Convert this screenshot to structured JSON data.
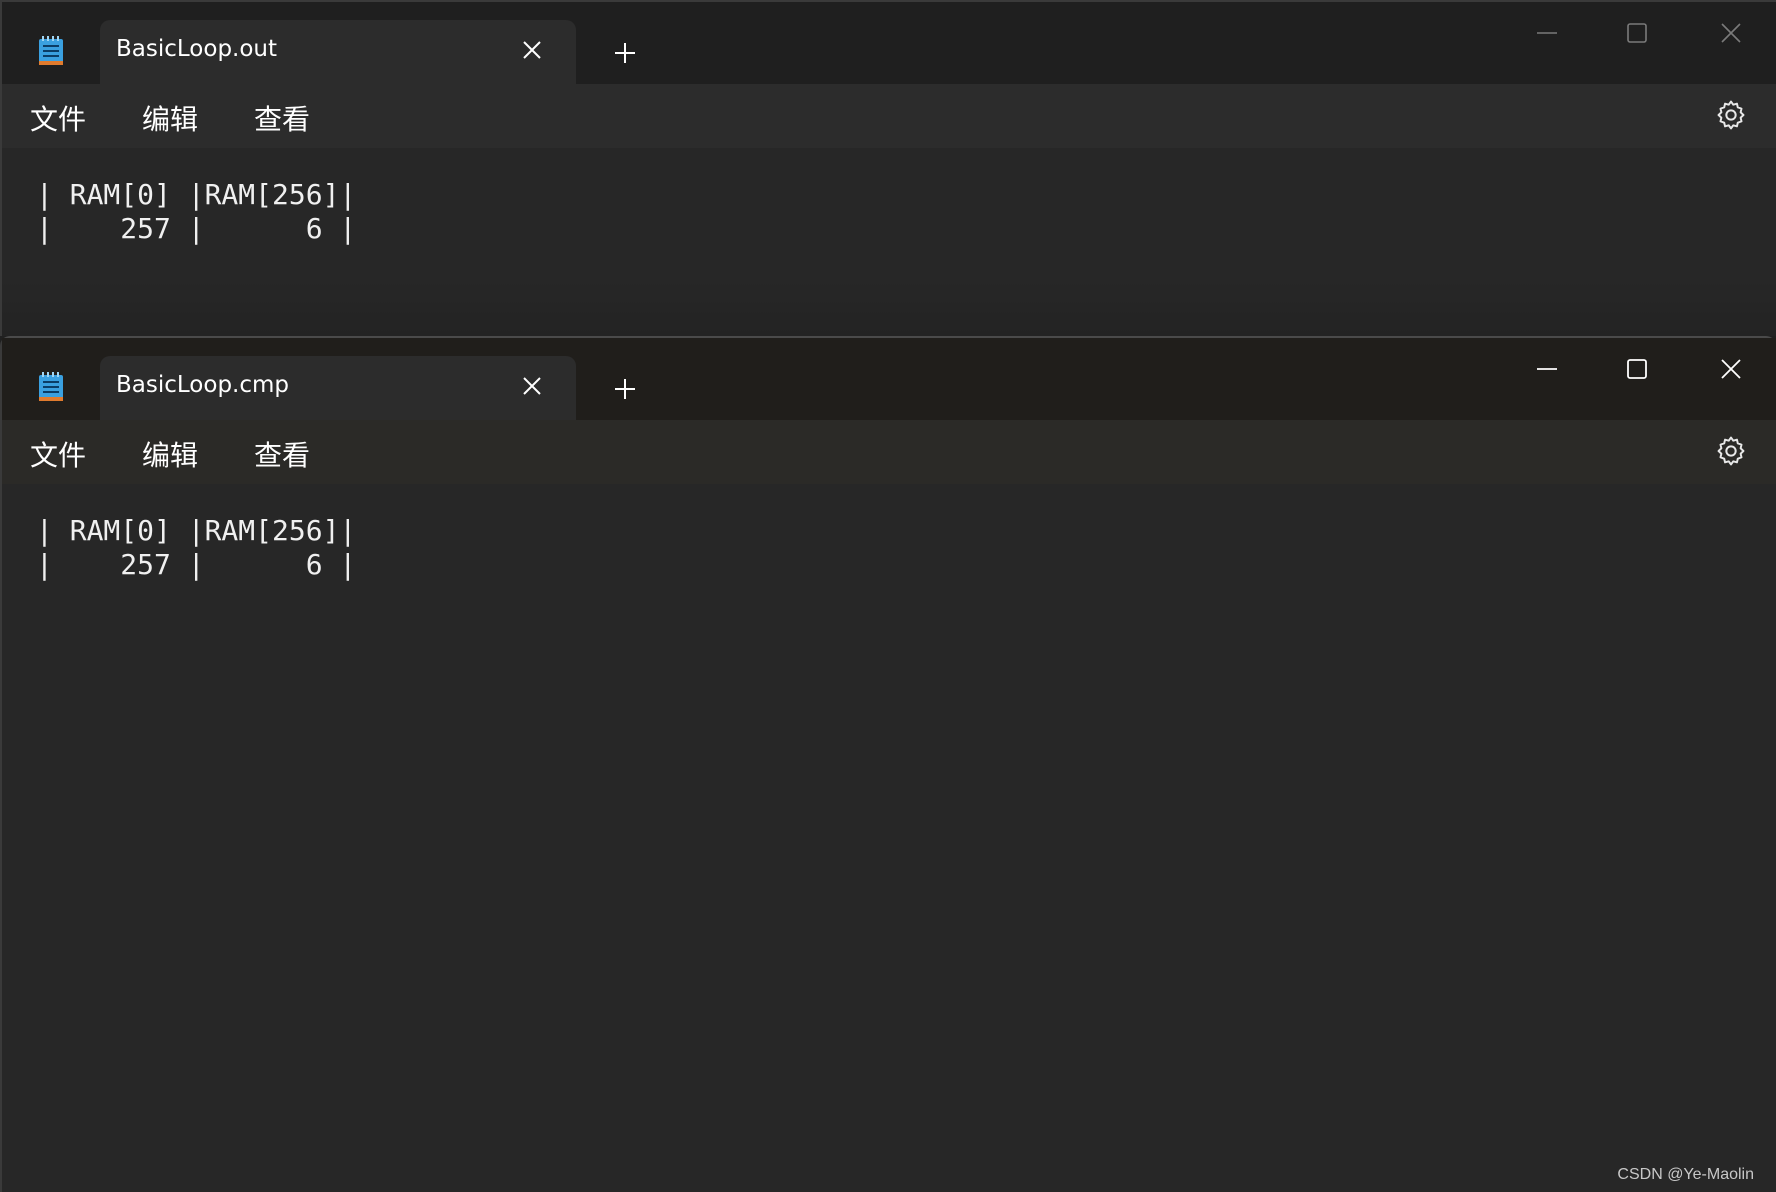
{
  "windows": [
    {
      "tab_title": "BasicLoop.out",
      "menu": {
        "file": "文件",
        "edit": "编辑",
        "view": "查看"
      },
      "content": "| RAM[0] |RAM[256]|\n|    257 |      6 |"
    },
    {
      "tab_title": "BasicLoop.cmp",
      "menu": {
        "file": "文件",
        "edit": "编辑",
        "view": "查看"
      },
      "content": "| RAM[0] |RAM[256]|\n|    257 |      6 |"
    }
  ],
  "icons": {
    "app": "notepad-icon",
    "tab_close": "close-icon",
    "new_tab": "plus-icon",
    "minimize": "minimize-icon",
    "maximize": "maximize-icon",
    "close": "close-icon",
    "settings": "gear-icon"
  },
  "colors": {
    "titlebar": "#1f1f1f",
    "tab_active": "#2c2c2c",
    "editor_bg": "#272727",
    "text": "#ffffff",
    "icon_accent": "#3aa0e0"
  },
  "watermark": "CSDN @Ye-Maolin"
}
